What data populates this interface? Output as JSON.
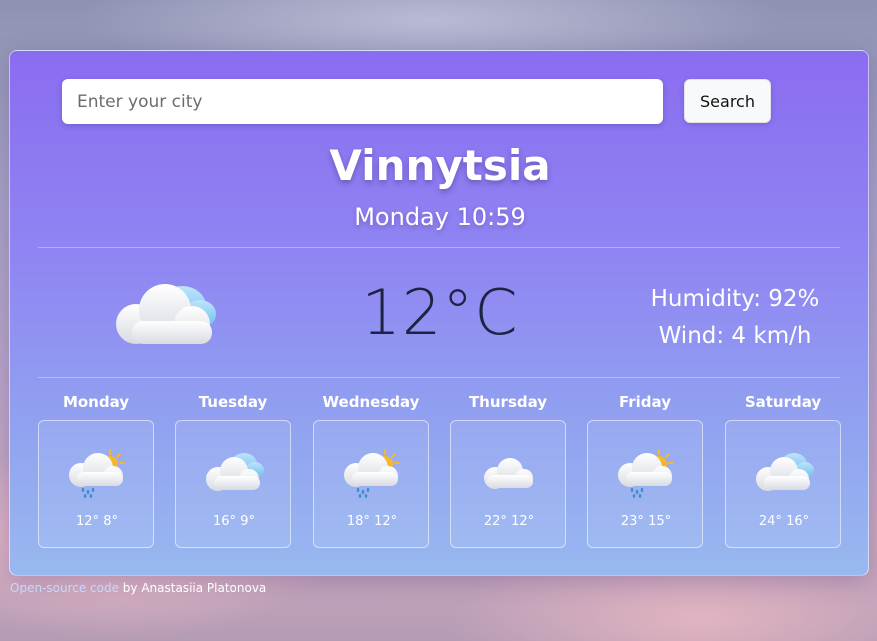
{
  "search": {
    "placeholder": "Enter your city",
    "value": "",
    "button_label": "Search"
  },
  "current": {
    "city": "Vinnytsia",
    "datetime": "Monday 10:59",
    "temperature": "12°C",
    "icon": "cloudy-icon",
    "humidity": "Humidity: 92%",
    "wind": "Wind: 4 km/h"
  },
  "forecast": [
    {
      "day": "Monday",
      "temps": "12° 8°",
      "icon": "rain-sun-icon"
    },
    {
      "day": "Tuesday",
      "temps": "16° 9°",
      "icon": "cloudy-icon"
    },
    {
      "day": "Wednesday",
      "temps": "18° 12°",
      "icon": "rain-sun-icon"
    },
    {
      "day": "Thursday",
      "temps": "22° 12°",
      "icon": "cloud-icon"
    },
    {
      "day": "Friday",
      "temps": "23° 15°",
      "icon": "rain-sun-icon"
    },
    {
      "day": "Saturday",
      "temps": "24° 16°",
      "icon": "cloudy-icon"
    }
  ],
  "footer": {
    "link_text": "Open-source code",
    "text": " by Anastasiia Platonova"
  },
  "colors": {
    "card_top": "#8b6cf1",
    "card_bottom": "#99b8f0",
    "temp_text": "#1d2340",
    "sun": "#f6b82b",
    "rain": "#3f8fd0"
  }
}
